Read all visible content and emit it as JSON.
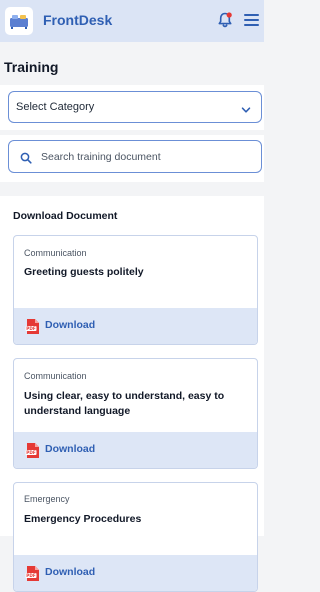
{
  "header": {
    "brand": "FrontDesk",
    "logo_icon": "frontdesk-logo-icon",
    "notification_icon": "bell-icon",
    "menu_icon": "hamburger-menu-icon",
    "accent_color": "#2f5fb3",
    "notification_dot_color": "#e53935"
  },
  "page": {
    "title": "Training"
  },
  "category_select": {
    "value": "Select Category",
    "icon": "chevron-down-icon"
  },
  "search": {
    "placeholder": "Search training document",
    "value": "",
    "icon": "search-icon"
  },
  "documents": {
    "section_title": "Download Document",
    "items": [
      {
        "category": "Communication",
        "title": "Greeting guests politely",
        "download_label": "Download",
        "file_icon": "pdf-icon"
      },
      {
        "category": "Communication",
        "title": "Using clear, easy to understand, easy to understand language",
        "download_label": "Download",
        "file_icon": "pdf-icon"
      },
      {
        "category": "Emergency",
        "title": "Emergency Procedures",
        "download_label": "Download",
        "file_icon": "pdf-icon"
      }
    ]
  }
}
